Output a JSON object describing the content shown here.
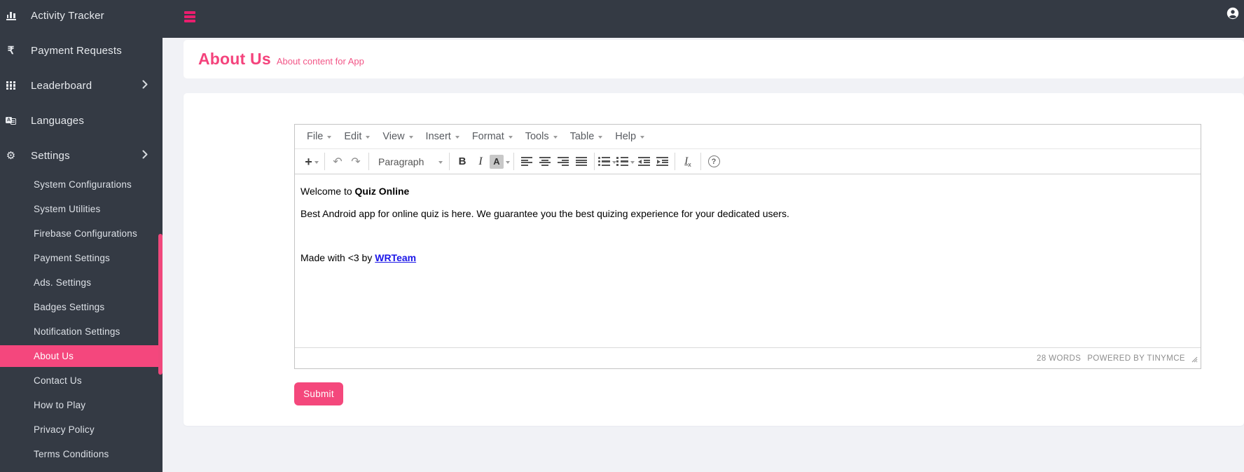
{
  "topbar": {
    "icons": {
      "hamburger": "three-bars-menu",
      "avatar": "person-in-circle"
    }
  },
  "sidebar": {
    "items": [
      {
        "label": "Activity Tracker",
        "icon": "bar-chart",
        "expandable": false
      },
      {
        "label": "Payment Requests",
        "icon": "rupee",
        "expandable": false
      },
      {
        "label": "Leaderboard",
        "icon": "grid-3x3",
        "expandable": true
      },
      {
        "label": "Languages",
        "icon": "translate",
        "expandable": false
      },
      {
        "label": "Settings",
        "icon": "gear",
        "expandable": true
      }
    ],
    "submenu": [
      "System Configurations",
      "System Utilities",
      "Firebase Configurations",
      "Payment Settings",
      "Ads. Settings",
      "Badges Settings",
      "Notification Settings",
      "About Us",
      "Contact Us",
      "How to Play",
      "Privacy Policy",
      "Terms Conditions"
    ],
    "active_item": "About Us"
  },
  "header": {
    "title": "About Us",
    "subtitle": "About content for App"
  },
  "editor": {
    "menubar": [
      "File",
      "Edit",
      "View",
      "Insert",
      "Format",
      "Tools",
      "Table",
      "Help"
    ],
    "format_select": "Paragraph",
    "glyphs": {
      "plus": "+",
      "undo": "↶",
      "redo": "↷",
      "bold": "B",
      "italic": "I",
      "forecolor": "A",
      "rupee": "₹",
      "gear": "⚙",
      "lang_letter": "A",
      "clear_i": "I",
      "clear_x": "x",
      "help": "?"
    },
    "content": {
      "p1_text": "Welcome to ",
      "p1_bold": "Quiz Online",
      "p2": "Best Android app for online quiz is here. We guarantee you the best quizing experience for your dedicated users.",
      "p4_text": "Made with <3 by ",
      "p4_link": "WRTeam"
    },
    "statusbar": {
      "word_count": "28 WORDS",
      "branding": "POWERED BY TINYMCE"
    }
  },
  "actions": {
    "submit": "Submit"
  },
  "colors": {
    "dark_bg": "#343a44",
    "page_bg": "#f1f2f6",
    "accent_pink": "#f4477d",
    "hamburger_pink": "#e91e6e",
    "link_blue": "#1b16e8",
    "card_bg": "#ffffff"
  }
}
